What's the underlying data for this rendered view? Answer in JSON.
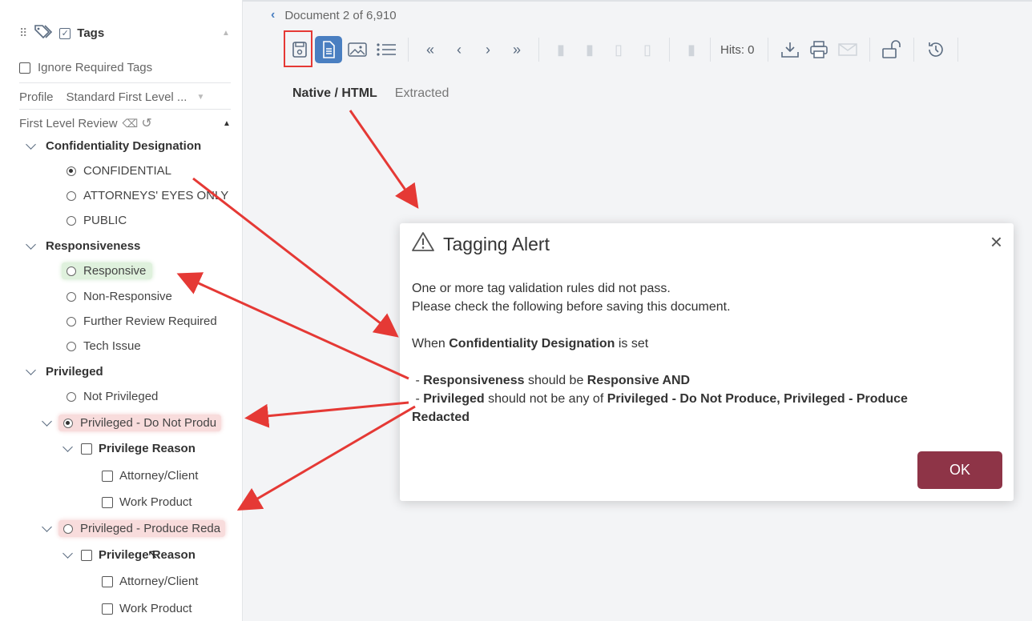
{
  "sidebar": {
    "header": "Tags",
    "ignore_required": "Ignore Required Tags",
    "profile_label": "Profile",
    "profile_value": "Standard First Level ...",
    "review_label": "First Level Review",
    "groups": {
      "confidentiality": {
        "label": "Confidentiality Designation",
        "options": [
          "CONFIDENTIAL",
          "ATTORNEYS' EYES ONLY",
          "PUBLIC"
        ]
      },
      "responsiveness": {
        "label": "Responsiveness",
        "options": [
          "Responsive",
          "Non-Responsive",
          "Further Review Required",
          "Tech Issue"
        ]
      },
      "privileged": {
        "label": "Privileged",
        "options": [
          "Not Privileged",
          "Privileged - Do Not Produ",
          "Privileged - Produce Reda"
        ],
        "reason_label": "Privilege Reason",
        "reasons": [
          "Attorney/Client",
          "Work Product"
        ],
        "reason_label_2": "Privilege Reason",
        "reasons_2": [
          "Attorney/Client",
          "Work Product"
        ]
      }
    }
  },
  "viewer": {
    "doc_count": "Document 2 of 6,910",
    "hits": "Hits: 0",
    "tabs": [
      "Native / HTML",
      "Extracted"
    ]
  },
  "dialog": {
    "title": "Tagging Alert",
    "line1": "One or more tag validation rules did not pass.",
    "line2": "Please check the following before saving this document.",
    "when_prefix": "When ",
    "when_field": "Confidentiality Designation",
    "when_suffix": " is set",
    "r1_field": "Responsiveness",
    "r1_mid": " should be ",
    "r1_value": "Responsive AND",
    "r2_field": "Privileged",
    "r2_mid": " should not be any of ",
    "r2_value": "Privileged - Do Not Produce, Privileged - Produce Redacted",
    "ok": "OK"
  },
  "colors": {
    "accent": "#4a7fc1",
    "ok_button": "#8e3447",
    "arrow": "#e53935"
  }
}
